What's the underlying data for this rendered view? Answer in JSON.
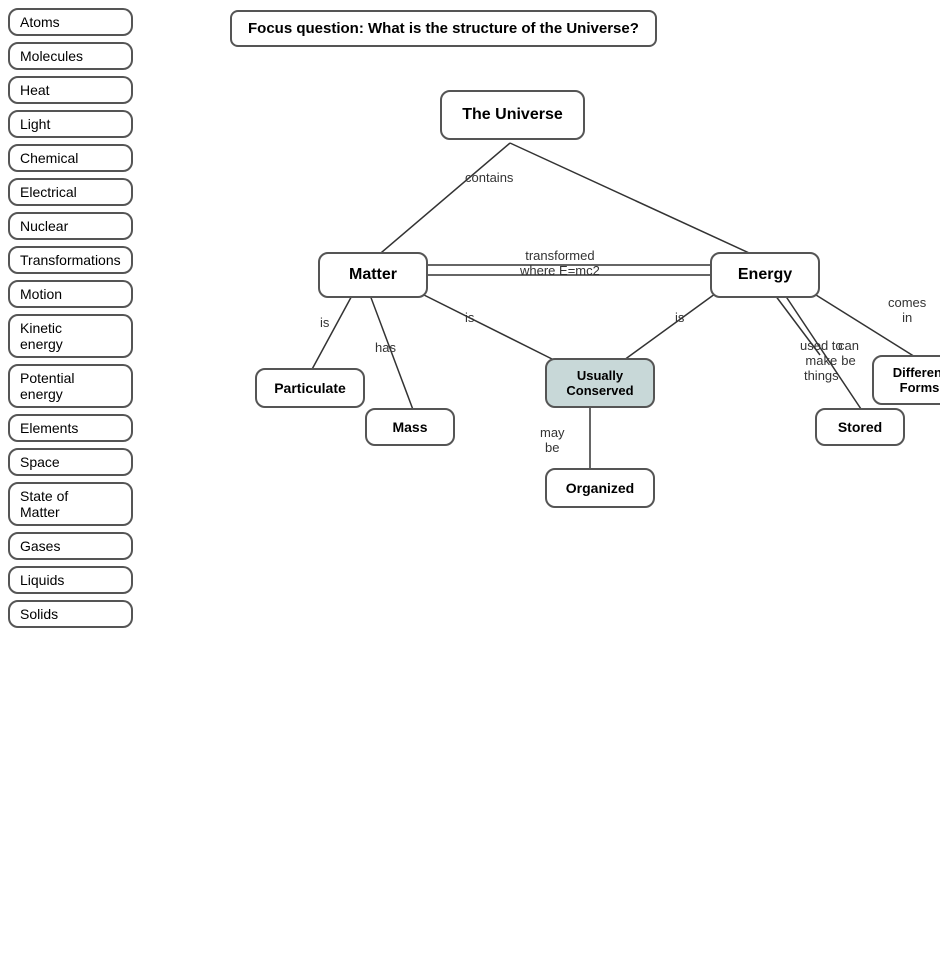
{
  "sidebar": {
    "items": [
      {
        "label": "Atoms"
      },
      {
        "label": "Molecules"
      },
      {
        "label": "Heat"
      },
      {
        "label": "Light"
      },
      {
        "label": "Chemical"
      },
      {
        "label": "Electrical"
      },
      {
        "label": "Nuclear"
      },
      {
        "label": "Transformations"
      },
      {
        "label": "Motion"
      },
      {
        "label": "Kinetic\nenergy"
      },
      {
        "label": "Potential\nenergy"
      },
      {
        "label": "Elements"
      },
      {
        "label": "Space"
      },
      {
        "label": "State of\nMatter"
      },
      {
        "label": "Gases"
      },
      {
        "label": "Liquids"
      },
      {
        "label": "Solids"
      }
    ]
  },
  "focus_question": "Focus question: What is the structure of the Universe?",
  "nodes": {
    "universe": {
      "label": "The Universe"
    },
    "matter": {
      "label": "Matter"
    },
    "energy": {
      "label": "Energy"
    },
    "usually_conserved": {
      "label": "Usually\nConserved"
    },
    "particulate": {
      "label": "Particulate"
    },
    "mass": {
      "label": "Mass"
    },
    "organized": {
      "label": "Organized"
    },
    "stored": {
      "label": "Stored"
    },
    "different_forms": {
      "label": "Different\nForms"
    }
  },
  "connector_labels": {
    "contains": "contains",
    "transformed": "transformed\nwhere E=mc2",
    "is1": "is",
    "is2": "is",
    "is3": "is",
    "has": "has",
    "may_be": "may\nbe",
    "used_to": "used to\nmake\nthings",
    "can_be": "can\nbe",
    "comes_in": "comes\nin"
  }
}
